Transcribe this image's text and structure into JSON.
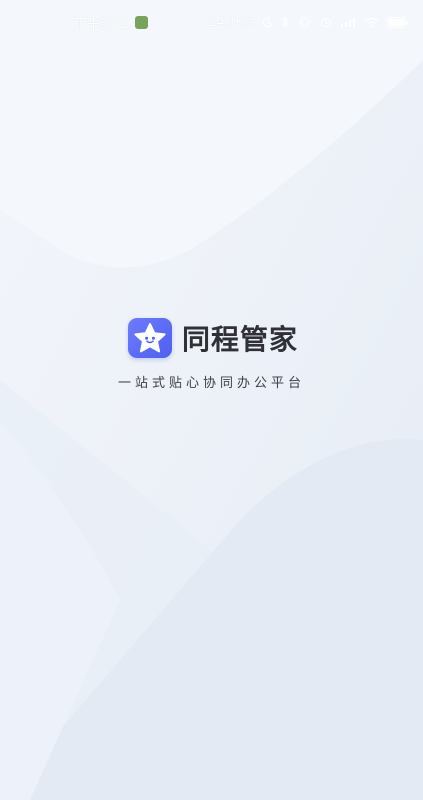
{
  "status_bar": {
    "time": "下午3:32",
    "network_speed": "14.1K/s",
    "notification_icon": "app-notification-icon",
    "right_icons": [
      "moon-icon",
      "bluetooth-icon",
      "vibrate-icon",
      "alarm-icon",
      "signal-icon",
      "wifi-icon",
      "battery-icon"
    ]
  },
  "splash": {
    "app_name": "同程管家",
    "tagline": "一站式贴心协同办公平台",
    "icon": "star-face-icon",
    "accent_color": "#5a6af6"
  }
}
